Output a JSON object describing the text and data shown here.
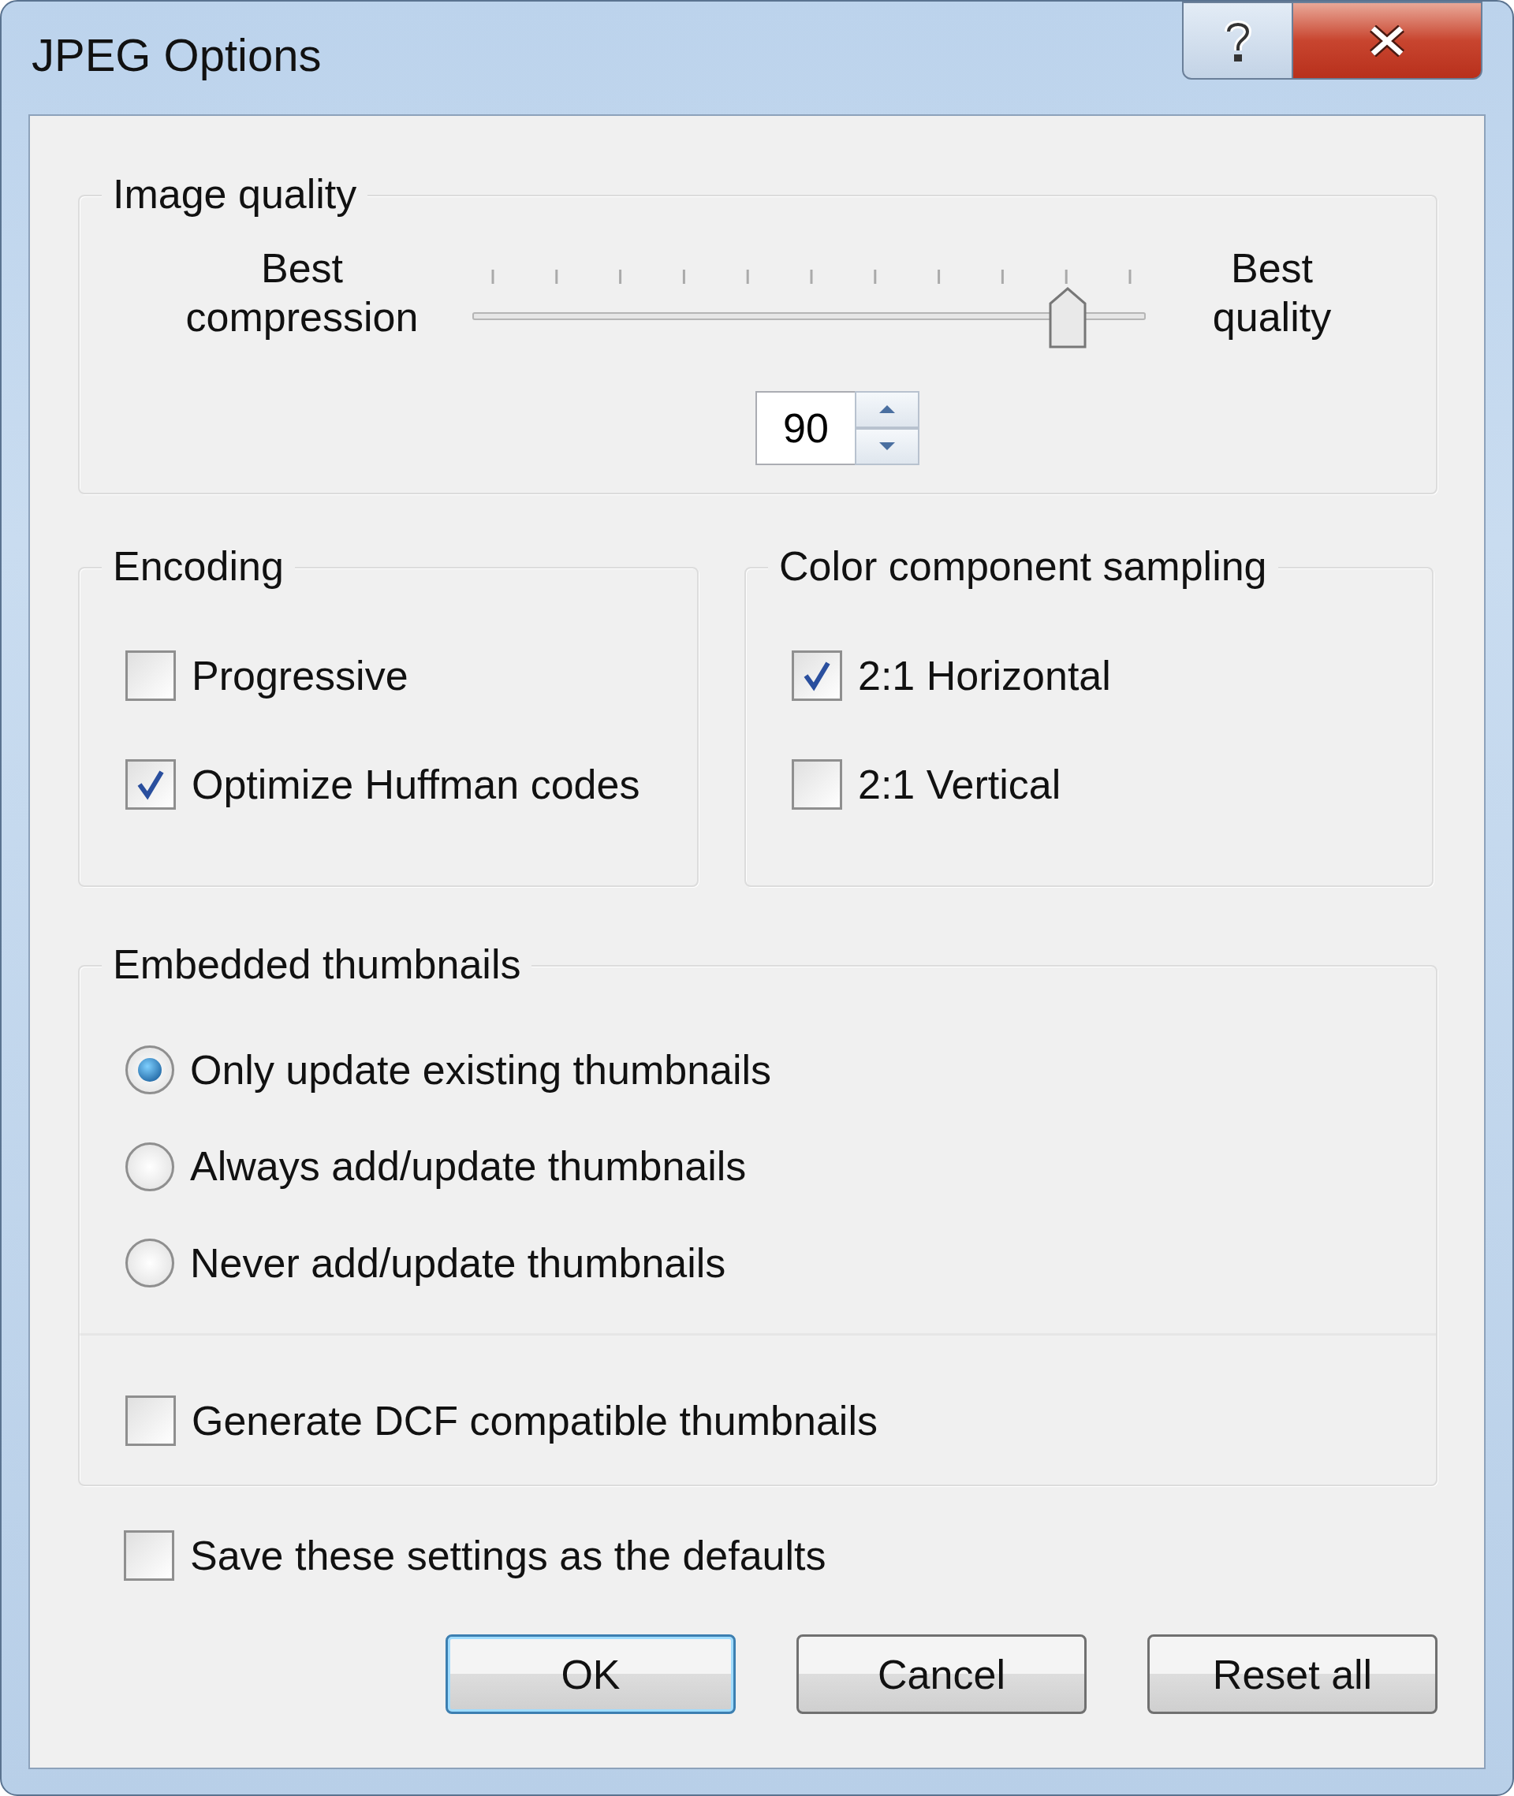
{
  "window": {
    "title": "JPEG Options"
  },
  "image_quality": {
    "legend": "Image quality",
    "min_label": "Best compression",
    "max_label": "Best quality",
    "level": 0.9,
    "value": "90"
  },
  "encoding": {
    "legend": "Encoding",
    "options": [
      {
        "label": "Progressive",
        "checked": false
      },
      {
        "label": "Optimize Huffman codes",
        "checked": true
      }
    ]
  },
  "color_sampling": {
    "legend": "Color component sampling",
    "options": [
      {
        "label": "2:1 Horizontal",
        "checked": true
      },
      {
        "label": "2:1 Vertical",
        "checked": false
      }
    ]
  },
  "thumbnails": {
    "legend": "Embedded thumbnails",
    "options": [
      {
        "label": "Only update existing thumbnails",
        "selected": true
      },
      {
        "label": "Always add/update thumbnails",
        "selected": false
      },
      {
        "label": "Never add/update thumbnails",
        "selected": false
      }
    ],
    "dcf": {
      "label": "Generate DCF compatible thumbnails",
      "checked": false
    }
  },
  "save_defaults": {
    "label": "Save these settings as the defaults",
    "checked": false
  },
  "buttons": [
    {
      "label": "OK",
      "default": true
    },
    {
      "label": "Cancel",
      "default": false
    },
    {
      "label": "Reset all",
      "default": false
    }
  ]
}
